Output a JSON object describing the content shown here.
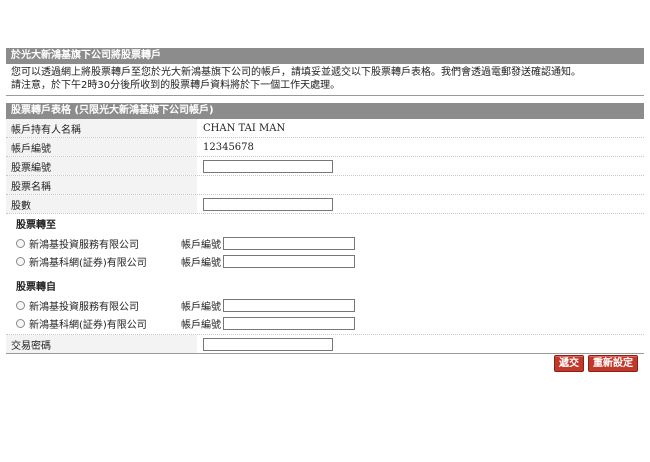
{
  "transfer_section": {
    "title": "於光大新鴻基旗下公司將股票轉戶",
    "notice_line1": "您可以透過網上將股票轉戶至您於光大新鴻基旗下公司的帳戶，請填妥並遞交以下股票轉戶表格。我們會透過電郵發送確認通知。",
    "notice_line2": "請注意，於下午2時30分後所收到的股票轉戶資料將於下一個工作天處理。"
  },
  "form": {
    "title": "股票轉戶表格 (只限光大新鴻基旗下公司帳戶)",
    "holder_label": "帳戶持有人名稱",
    "holder_value": "CHAN TAI MAN",
    "account_label": "帳戶編號",
    "account_value": "12345678",
    "stock_code_label": "股票編號",
    "stock_code_value": "",
    "stock_name_label": "股票名稱",
    "stock_name_value": "",
    "quantity_label": "股數",
    "quantity_value": "",
    "transfer_to": {
      "heading": "股票轉至",
      "options": [
        {
          "company": "新鴻基投資服務有限公司",
          "account_label": "帳戶編號",
          "account_value": ""
        },
        {
          "company": "新鴻基科網(証券)有限公司",
          "account_label": "帳戶編號",
          "account_value": ""
        }
      ]
    },
    "transfer_from": {
      "heading": "股票轉自",
      "options": [
        {
          "company": "新鴻基投資服務有限公司",
          "account_label": "帳戶編號",
          "account_value": ""
        },
        {
          "company": "新鴻基科網(証券)有限公司",
          "account_label": "帳戶編號",
          "account_value": ""
        }
      ]
    },
    "password_label": "交易密碼",
    "password_value": ""
  },
  "actions": {
    "submit_label": "遞交",
    "reset_label": "重新設定"
  },
  "colors": {
    "header_bar": "#8c8c8c",
    "button_red": "#c0392b"
  }
}
